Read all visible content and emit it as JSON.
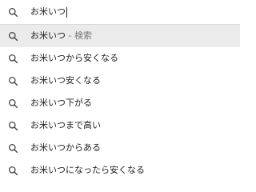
{
  "search": {
    "query": "お米いつ",
    "icon": "search-icon"
  },
  "suggestions": [
    {
      "text": "お米いつ",
      "suffix": " - 検索",
      "highlighted": true
    },
    {
      "text": "お米いつから安くなる"
    },
    {
      "text": "お米いつ安くなる"
    },
    {
      "text": "お米いつ下がる"
    },
    {
      "text": "お米いつまで高い"
    },
    {
      "text": "お米いつからある"
    },
    {
      "text": "お米いつになったら安くなる"
    }
  ],
  "colors": {
    "highlight": "#ebebeb",
    "text": "#202124",
    "muted": "#7a7a7a"
  }
}
